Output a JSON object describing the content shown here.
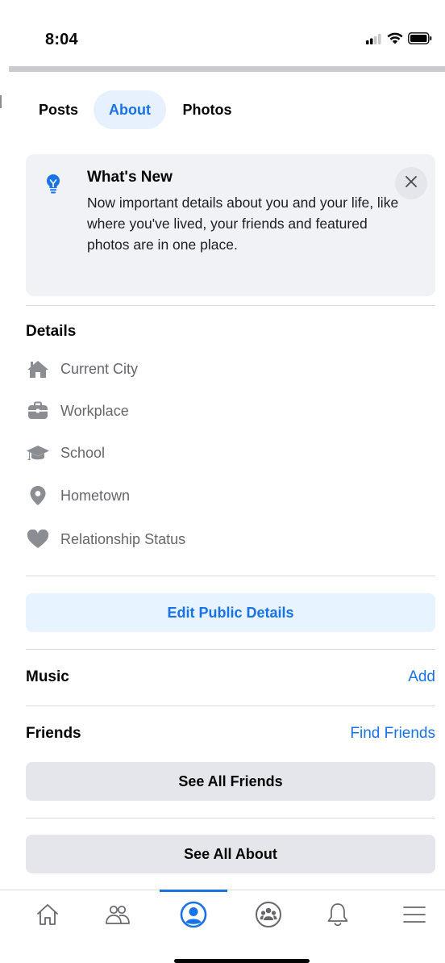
{
  "status_bar": {
    "time": "8:04",
    "icons": [
      "signal-icon",
      "wifi-icon",
      "battery-icon"
    ]
  },
  "tabs": [
    {
      "label": "Posts",
      "active": false
    },
    {
      "label": "About",
      "active": true
    },
    {
      "label": "Photos",
      "active": false
    }
  ],
  "whats_new": {
    "icon": "lightbulb-icon",
    "title": "What's New",
    "body": "Now important details about you and your life, like where you've lived, your friends and featured photos are in one place.",
    "close_icon": "close-icon"
  },
  "details": {
    "title": "Details",
    "items": [
      {
        "label": "Current City",
        "icon": "home-icon"
      },
      {
        "label": "Workplace",
        "icon": "briefcase-icon"
      },
      {
        "label": "School",
        "icon": "graduation-cap-icon"
      },
      {
        "label": "Hometown",
        "icon": "location-pin-icon"
      },
      {
        "label": "Relationship Status",
        "icon": "heart-icon"
      }
    ],
    "edit_button": "Edit Public Details"
  },
  "music": {
    "title": "Music",
    "action": "Add"
  },
  "friends": {
    "title": "Friends",
    "action": "Find Friends",
    "see_all": "See All Friends"
  },
  "about": {
    "see_all": "See All About"
  },
  "bottom_nav": {
    "items": [
      "home-icon",
      "friends-icon",
      "profile-icon",
      "groups-icon",
      "notifications-icon",
      "menu-icon"
    ],
    "active": "profile-icon"
  },
  "colors": {
    "accent": "#1873e6",
    "accent_bg": "#e7f3ff",
    "card_bg": "#f0f2f5",
    "button_gray": "#e4e6eb",
    "secondary_text": "#65676b",
    "icon_gray": "#8a8d91"
  }
}
